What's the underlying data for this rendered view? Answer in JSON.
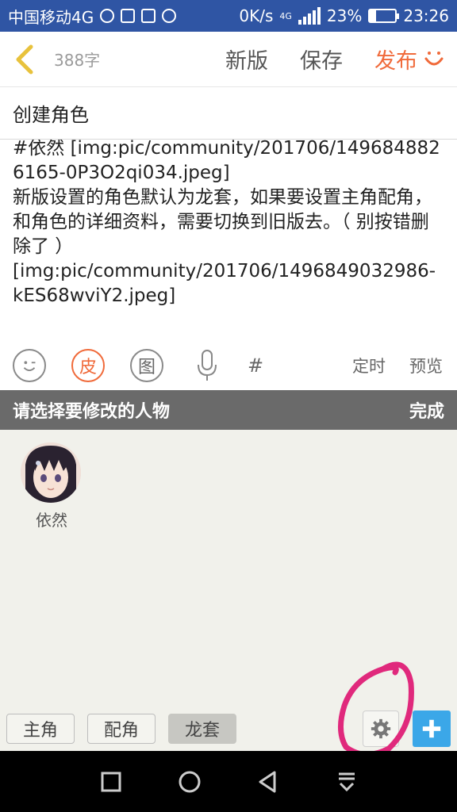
{
  "status_bar": {
    "carrier": "中国移动4G",
    "speed": "0K/s",
    "network": "4G",
    "battery": "23%",
    "battery_level": 0.23,
    "time": "23:26"
  },
  "app_bar": {
    "word_count": "388字",
    "new_version": "新版",
    "save": "保存",
    "publish": "发布"
  },
  "editor": {
    "title": "创建角色",
    "lines": [
      "#依然 [img:pic/community/201706/1496848826165-0P3O2qi034.jpeg]",
      "新版设置的角色默认为龙套，如果要设置主角配角，和角色的详细资料，需要切换到旧版去。（ 别按错删除了 ）",
      "[img:pic/community/201706/1496849032986-kES68wviY2.jpeg]"
    ]
  },
  "toolbar": {
    "skin": "皮",
    "image": "图",
    "hash": "#",
    "schedule": "定时",
    "preview": "预览"
  },
  "picker": {
    "header": "请选择要修改的人物",
    "done": "完成",
    "characters": [
      {
        "name": "依然"
      }
    ],
    "roles": [
      "主角",
      "配角",
      "龙套"
    ],
    "selected_role": "龙套"
  },
  "colors": {
    "status_bar": "#2f55a4",
    "accent_orange": "#f06a3a",
    "back_arrow": "#e8c23c",
    "picker_header": "#6a6a6a",
    "add_button": "#3ba7e8",
    "annotation_pink": "#e0297c"
  }
}
